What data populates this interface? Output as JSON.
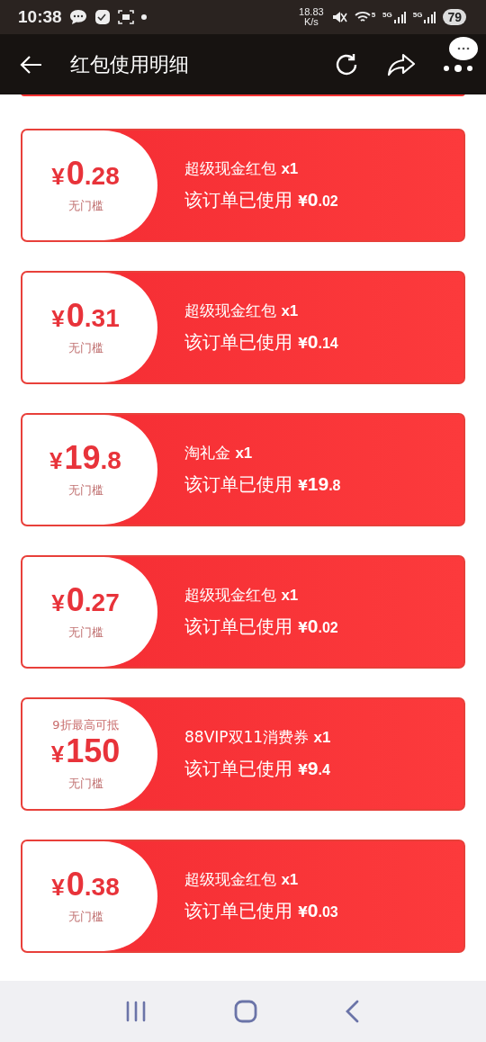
{
  "status_bar": {
    "time": "10:38",
    "net_speed": "18.83",
    "net_unit": "K/s",
    "wifi_label": "5",
    "signal_labels": [
      "5G",
      "5G"
    ],
    "battery": "79"
  },
  "header": {
    "title": "红包使用明细"
  },
  "coupons": [
    {
      "currency": "¥",
      "amount_int": "0",
      "amount_dec": ".28",
      "threshold": "无门槛",
      "name": "超级现金红包",
      "qty": "x1",
      "used_label": "该订单已使用",
      "used_currency": "¥",
      "used_int": "0",
      "used_dec": ".02"
    },
    {
      "currency": "¥",
      "amount_int": "0",
      "amount_dec": ".31",
      "threshold": "无门槛",
      "name": "超级现金红包",
      "qty": "x1",
      "used_label": "该订单已使用",
      "used_currency": "¥",
      "used_int": "0",
      "used_dec": ".14"
    },
    {
      "currency": "¥",
      "amount_int": "19",
      "amount_dec": ".8",
      "threshold": "无门槛",
      "name": "淘礼金",
      "qty": "x1",
      "used_label": "该订单已使用",
      "used_currency": "¥",
      "used_int": "19",
      "used_dec": ".8"
    },
    {
      "currency": "¥",
      "amount_int": "0",
      "amount_dec": ".27",
      "threshold": "无门槛",
      "name": "超级现金红包",
      "qty": "x1",
      "used_label": "该订单已使用",
      "used_currency": "¥",
      "used_int": "0",
      "used_dec": ".02"
    },
    {
      "note": "9折最高可抵",
      "currency": "¥",
      "amount_int": "150",
      "threshold": "无门槛",
      "name": "88VIP双11消费券",
      "qty": "x1",
      "used_label": "该订单已使用",
      "used_currency": "¥",
      "used_int": "9",
      "used_dec": ".4"
    },
    {
      "currency": "¥",
      "amount_int": "0",
      "amount_dec": ".38",
      "threshold": "无门槛",
      "name": "超级现金红包",
      "qty": "x1",
      "used_label": "该订单已使用",
      "used_currency": "¥",
      "used_int": "0",
      "used_dec": ".03"
    }
  ]
}
